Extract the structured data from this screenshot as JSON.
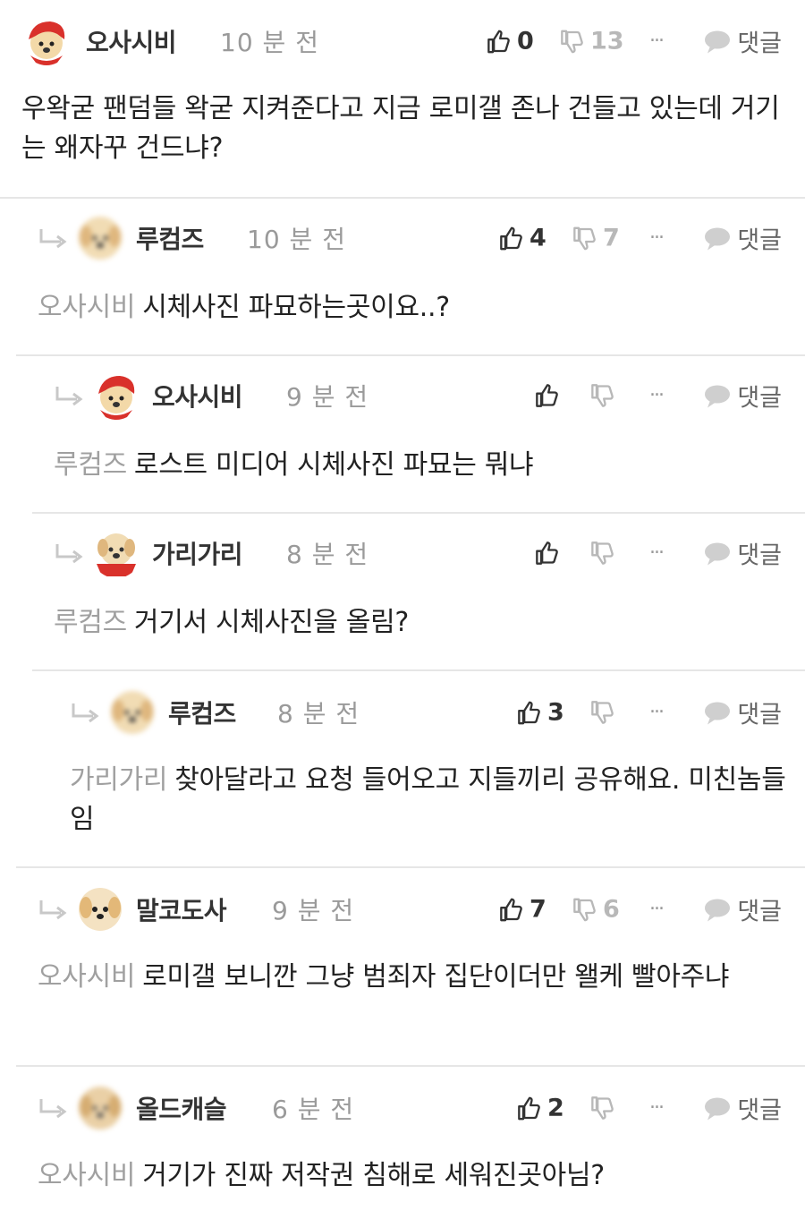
{
  "labels": {
    "reply": "댓글",
    "more": "···"
  },
  "comments": [
    {
      "username": "오사시비",
      "time": "10 분 전",
      "up": "0",
      "down": "13",
      "mention": "",
      "text": "우왁굳 팬덤들 왁굳 지켜준다고 지금 로미갤 존나 건들고 있는데 거기는 왜자꾸 건드냐?"
    },
    {
      "username": "루컴즈",
      "time": "10 분 전",
      "up": "4",
      "down": "7",
      "mention": "오사시비",
      "text": "시체사진 파묘하는곳이요..?"
    },
    {
      "username": "오사시비",
      "time": "9 분 전",
      "up": "",
      "down": "",
      "mention": "루컴즈",
      "text": "로스트 미디어 시체사진 파묘는 뭐냐"
    },
    {
      "username": "가리가리",
      "time": "8 분 전",
      "up": "",
      "down": "",
      "mention": "루컴즈",
      "text": "거기서 시체사진을 올림?"
    },
    {
      "username": "루컴즈",
      "time": "8 분 전",
      "up": "3",
      "down": "",
      "mention": "가리가리",
      "text": "찾아달라고 요청 들어오고 지들끼리 공유해요. 미친놈들임"
    },
    {
      "username": "말코도사",
      "time": "9 분 전",
      "up": "7",
      "down": "6",
      "mention": "오사시비",
      "text": "로미갤 보니깐 그냥 범죄자 집단이더만 왤케 빨아주냐"
    },
    {
      "username": "올드캐슬",
      "time": "6 분 전",
      "up": "2",
      "down": "",
      "mention": "오사시비",
      "text": "거기가 진짜 저작권 침해로 세워진곳아님?"
    }
  ]
}
